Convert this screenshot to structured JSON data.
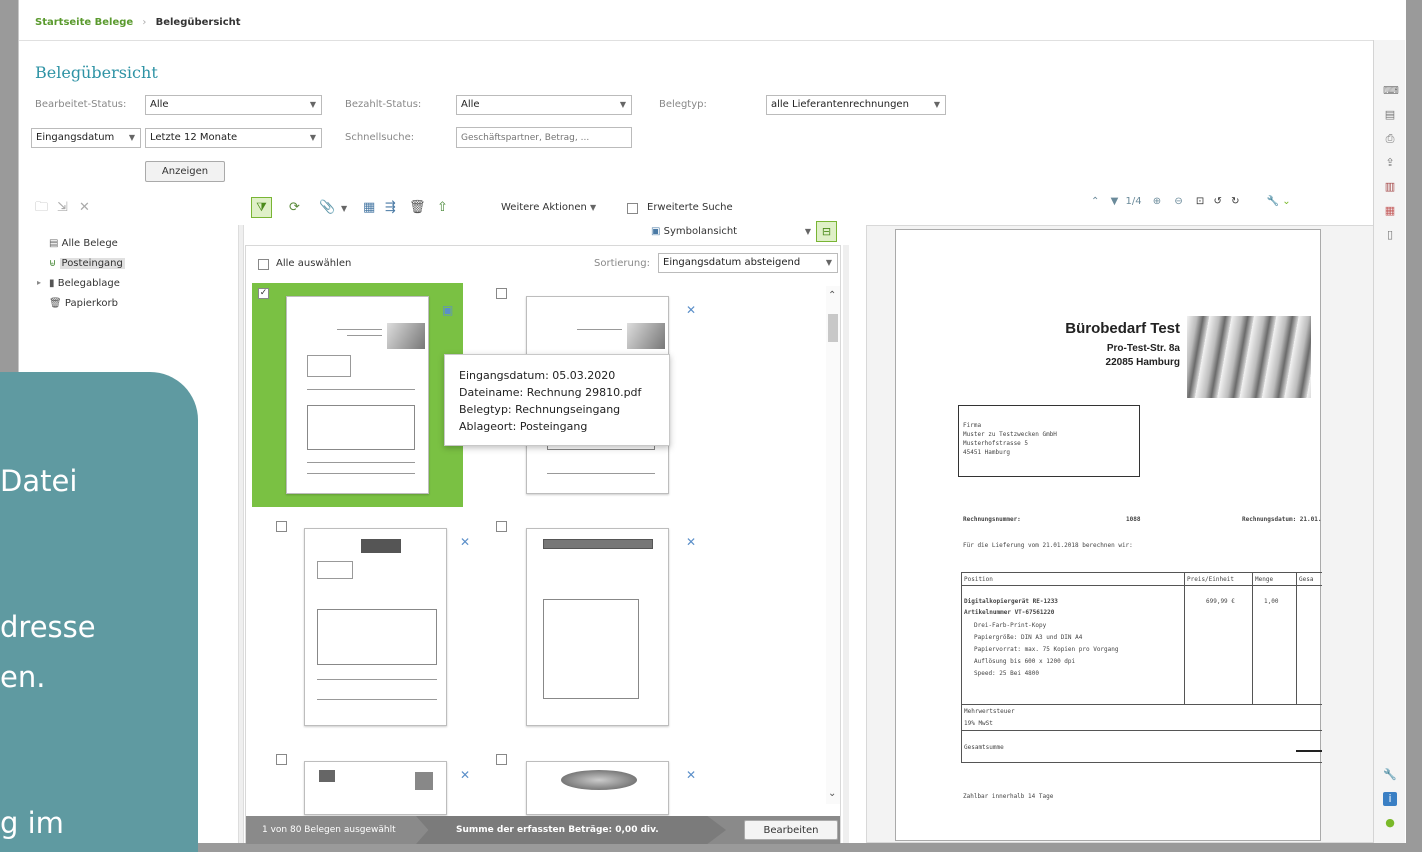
{
  "breadcrumb": {
    "home": "Startseite Belege",
    "current": "Belegübersicht"
  },
  "title": "Belegübersicht",
  "filters": {
    "bearbeitet_label": "Bearbeitet-Status:",
    "bearbeitet_value": "Alle",
    "bezahlt_label": "Bezahlt-Status:",
    "bezahlt_value": "Alle",
    "belegtyp_label": "Belegtyp:",
    "belegtyp_value": "alle Lieferantenrechnungen",
    "datumfeld_value": "Eingangsdatum",
    "zeitraum_value": "Letzte 12 Monate",
    "schnellsuche_label": "Schnellsuche:",
    "schnellsuche_placeholder": "Geschäftspartner, Betrag, ...",
    "show_button": "Anzeigen"
  },
  "toolbar": {
    "more_actions": "Weitere Aktionen",
    "extended_search": "Erweiterte Suche",
    "view_mode": "Symbolansicht",
    "page_indicator": "1/4"
  },
  "tree": {
    "items": [
      {
        "label": "Alle Belege"
      },
      {
        "label": "Posteingang"
      },
      {
        "label": "Belegablage"
      },
      {
        "label": "Papierkorb"
      }
    ]
  },
  "list": {
    "select_all": "Alle auswählen",
    "sort_label": "Sortierung:",
    "sort_value": "Eingangsdatum absteigend"
  },
  "tooltip": {
    "line1": "Eingangsdatum: 05.03.2020",
    "line2": "Dateiname: Rechnung 29810.pdf",
    "line3": "Belegtyp: Rechnungseingang",
    "line4": "Ablageort: Posteingang"
  },
  "status": {
    "selected": "1 von 80 Belegen ausgewählt",
    "sum": "Summe der erfassten Beträge: 0,00 div.",
    "edit_button": "Bearbeiten"
  },
  "preview": {
    "company": "Bürobedarf Test",
    "street": "Pro-Test-Str. 8a",
    "city": "22085 Hamburg",
    "addr1": "Firma",
    "addr2": "Muster zu Testzwecken GmbH",
    "addr3": "Musterhofstrasse 5",
    "addr4": "45451 Hamburg",
    "invno_label": "Rechnungsnummer:",
    "invno": "1088",
    "invdate_label": "Rechnungsdatum: 21.01.",
    "intro": "Für die Lieferung vom 21.01.2018 berechnen wir:",
    "col_pos": "Position",
    "col_price": "Preis/Einheit",
    "col_qty": "Menge",
    "col_extra": "Gesa",
    "item1": "Digitalkopiergerät RE-1233",
    "item2": "Artikelnummer VT-67561220",
    "item3": "Drei-Farb-Print-Kopy",
    "item4": "Papiergröße: DIN A3 und DIN A4",
    "item5": "Papiervorrat: max. 75 Kopien pro Vorgang",
    "item6": "Auflösung bis 600 x 1200 dpi",
    "item7": "Speed: 25 Bei 4800",
    "price": "699,99 €",
    "qty": "1,00",
    "mwst": "Mehrwertsteuer",
    "mwst_rate": "19% MwSt",
    "total": "Gesamtsumme",
    "payable": "Zahlbar innerhalb 14 Tage"
  },
  "overlay": {
    "line1": "Datei",
    "line2": "dresse",
    "line3": "en.",
    "line4": "g im"
  },
  "colors": {
    "accent": "#7ab929",
    "title": "#2e93a5",
    "overlay": "#5f9aa1"
  }
}
